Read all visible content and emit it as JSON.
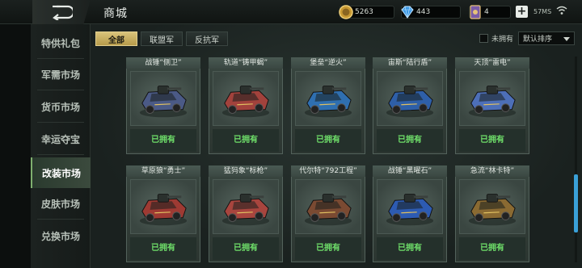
{
  "header": {
    "title": "商城",
    "gold": "5263",
    "gems": "443",
    "cards": "4",
    "plus_label": "+",
    "network": "57MS"
  },
  "sidebar": {
    "items": [
      {
        "label": "特供礼包"
      },
      {
        "label": "军需市场"
      },
      {
        "label": "货币市场"
      },
      {
        "label": "幸运夺宝"
      },
      {
        "label": "改装市场"
      },
      {
        "label": "皮肤市场"
      },
      {
        "label": "兑换市场"
      }
    ]
  },
  "filters": {
    "tabs": [
      {
        "label": "全部"
      },
      {
        "label": "联盟军"
      },
      {
        "label": "反抗军"
      }
    ],
    "own_label": "未拥有",
    "sort_value": "默认排序"
  },
  "items": [
    {
      "name": "战锤“侧卫”",
      "status": "已拥有",
      "color": "#4b5a86"
    },
    {
      "name": "轨道“铸甲蝎”",
      "status": "已拥有",
      "color": "#a2423c"
    },
    {
      "name": "堡垒“逆火”",
      "status": "已拥有",
      "color": "#2f6fb0"
    },
    {
      "name": "宙斯“陆行盾”",
      "status": "已拥有",
      "color": "#2e5fa8"
    },
    {
      "name": "天顶“雷电”",
      "status": "已拥有",
      "color": "#4d6fb8"
    },
    {
      "name": "草原狼“勇士”",
      "status": "已拥有",
      "color": "#9e3a33"
    },
    {
      "name": "猛犸象“标枪”",
      "status": "已拥有",
      "color": "#a8453e"
    },
    {
      "name": "代尔特“792工程”",
      "status": "已拥有",
      "color": "#7a4a32"
    },
    {
      "name": "战锤“黑曜石”",
      "status": "已拥有",
      "color": "#2d5bb2"
    },
    {
      "name": "急流“林卡特”",
      "status": "已拥有",
      "color": "#8a6a32"
    }
  ]
}
